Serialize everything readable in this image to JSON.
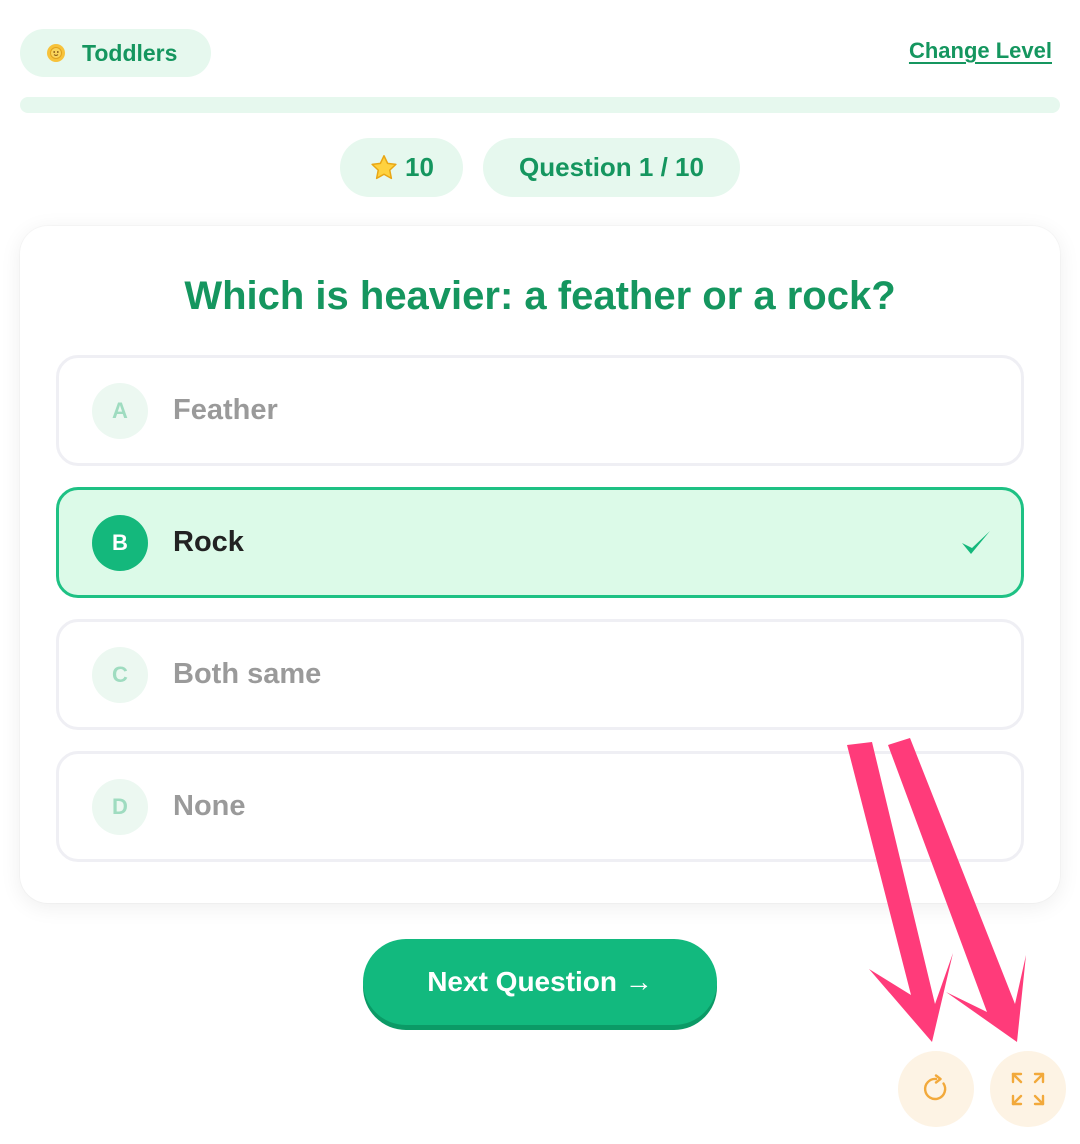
{
  "header": {
    "level_label": "Toddlers",
    "level_icon": "sun-face-icon",
    "change_level": "Change Level",
    "progress_fraction": 0.0
  },
  "stats": {
    "score_icon": "star-icon",
    "score": "10",
    "question_counter": "Question 1 / 10"
  },
  "quiz": {
    "question": "Which is heavier: a feather or a rock?",
    "options": [
      {
        "letter": "A",
        "text": "Feather",
        "selected": false
      },
      {
        "letter": "B",
        "text": "Rock",
        "selected": true
      },
      {
        "letter": "C",
        "text": "Both same",
        "selected": false
      },
      {
        "letter": "D",
        "text": "None",
        "selected": false
      }
    ],
    "selected_icon": "checkmark-icon"
  },
  "actions": {
    "next_label": "Next Question →",
    "restart_icon": "restart-icon",
    "fullscreen_icon": "fullscreen-icon"
  },
  "colors": {
    "brand_green": "#15965f",
    "accent_green": "#12b97e",
    "pill_bg": "#e6f8ee",
    "selected_bg": "#dcfae8",
    "control_bg": "#fdf3e4",
    "control_icon": "#f2a93b",
    "annotation_arrow": "#ff3b7a"
  }
}
